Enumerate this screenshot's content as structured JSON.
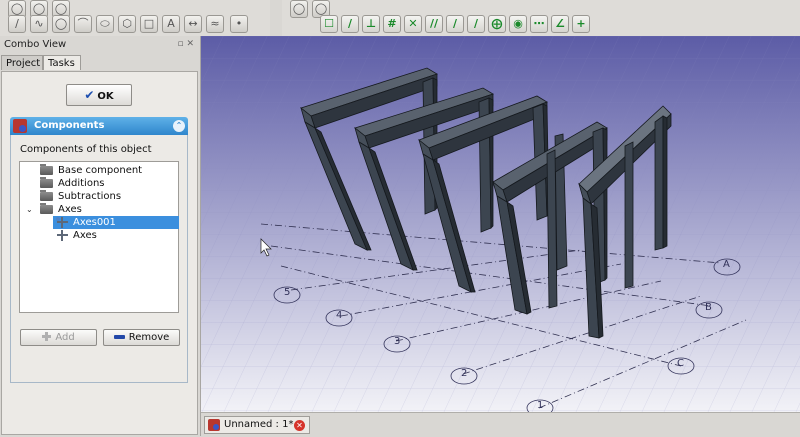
{
  "combo_view": {
    "title": "Combo View",
    "tabs": [
      {
        "label": "Project"
      },
      {
        "label": "Tasks"
      }
    ],
    "ok_label": "OK"
  },
  "components": {
    "header": "Components",
    "subtitle": "Components of this object",
    "tree": [
      {
        "label": "Base component"
      },
      {
        "label": "Additions"
      },
      {
        "label": "Subtractions"
      },
      {
        "label": "Axes"
      },
      {
        "label": "Axes001"
      },
      {
        "label": "Axes"
      }
    ],
    "add_label": "Add",
    "remove_label": "Remove"
  },
  "viewport": {
    "axis_labels": [
      "5",
      "4",
      "3",
      "2",
      "1",
      "A",
      "B",
      "C"
    ]
  },
  "document_tab": {
    "label": "Unnamed : 1*"
  },
  "colors": {
    "accent": "#3b8fde",
    "header_blue": "#2f86cc",
    "viewport_top": "#5c5ca6",
    "viewport_bottom": "#f2f2f7",
    "beam": "#3c4550"
  },
  "icons": [
    "check-icon",
    "components-icon",
    "collapse-icon",
    "folder-icon",
    "axes-icon",
    "plus-icon",
    "minus-icon",
    "freecad-icon",
    "close-icon",
    "cursor-icon"
  ]
}
